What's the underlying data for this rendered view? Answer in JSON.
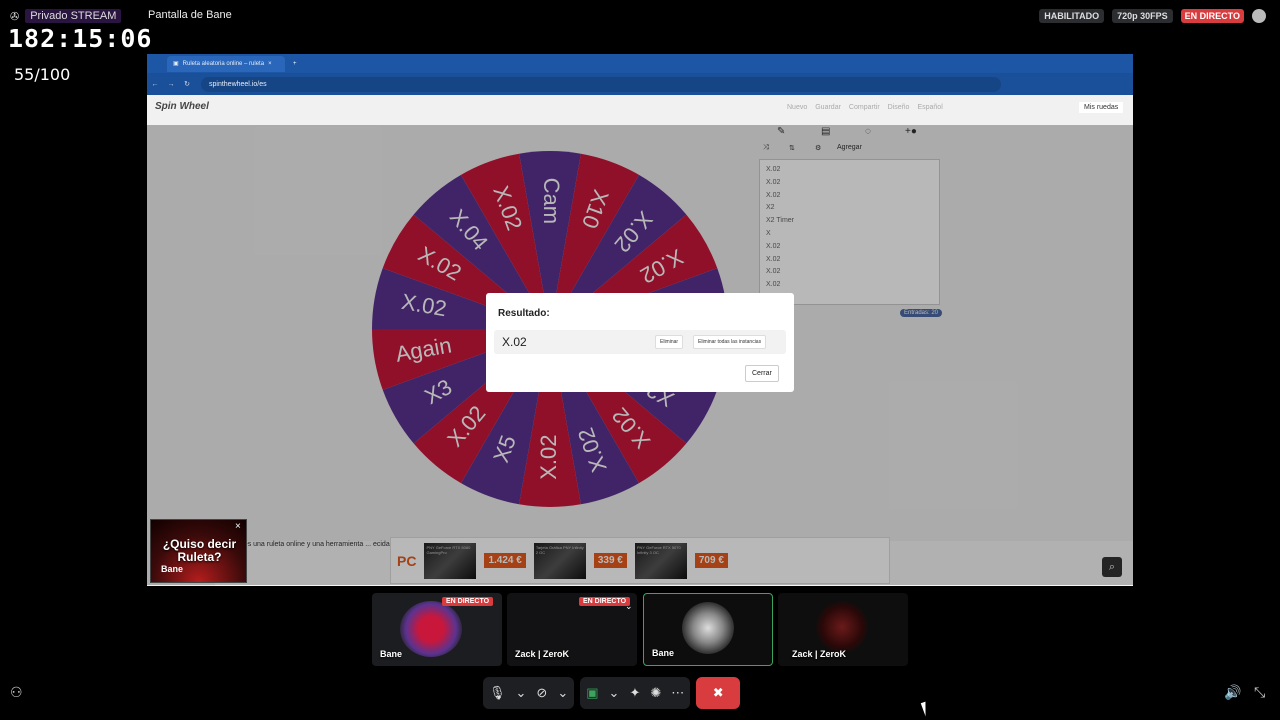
{
  "overlay": {
    "server_name": "Privado STREAM",
    "channel_name": "Pantalla de Bane",
    "clock": "182:15:06",
    "counter": "55/100",
    "enabled_badge": "HABILITADO",
    "quality_badge": "720p 30FPS",
    "live_badge": "EN DIRECTO"
  },
  "browser": {
    "tab_title": "Ruleta aleatoria online – ruleta",
    "url": "spinthewheel.io/es"
  },
  "site": {
    "logo": "Spin Wheel",
    "nav": [
      "Nuevo",
      "Guardar",
      "Compartir",
      "Diseño",
      "Español"
    ],
    "my_wheels": "Mis ruedas",
    "add_button": "Agregar",
    "entries": [
      "X.02",
      "X.02",
      "X.02",
      "X2",
      "X2 Timer",
      "X",
      "X.02",
      "X.02",
      "X.02",
      "X.02"
    ],
    "entries_count": "Entradas: 20",
    "description": "aleatoria es una ruleta online y una herramienta ... ecida por ti. Nuestra aplicación internacional ... plica temas y cambia los sonidos, y deja que la",
    "wheel_colors": {
      "red": "#c8173b",
      "purple": "#5b3390"
    },
    "wheel_labels": [
      "Cam",
      "X10",
      "X.02",
      "X.02",
      "X.02",
      "X2 Timer",
      "X2",
      "X.02",
      "X.02",
      "X.02",
      "X5",
      "X.02",
      "X3",
      "Again",
      "X.02",
      "X.02",
      "X.04",
      "X.02"
    ]
  },
  "modal": {
    "title": "Resultado:",
    "value": "X.02",
    "delete": "Eliminar",
    "delete_all": "Eliminar todas las instancias",
    "close": "Cerrar"
  },
  "ad": {
    "brand": "PC",
    "prices": [
      "1.424 €",
      "339 €",
      "709 €"
    ],
    "products": [
      "PNY GeForce RTX 5080 GamingPro",
      "Tarjeta Gráfica PNY Infinity 2 GC",
      "PNY GeForce RTX 5070 Infinity 3 OC"
    ]
  },
  "popup": {
    "text": "¿Quiso decir Ruleta?",
    "name": "Bane"
  },
  "participants": [
    {
      "name": "Bane",
      "live": "EN DIRECTO"
    },
    {
      "name": "Zack | ZeroK",
      "live": "EN DIRECTO"
    },
    {
      "name": "Bane",
      "live": ""
    },
    {
      "name": "Zack | ZeroK",
      "live": ""
    }
  ],
  "icons": {
    "mic": "microphone-icon",
    "camera_off": "camera-off-icon",
    "screen_share": "screen-share-icon",
    "activities": "activities-icon",
    "soundboard": "soundboard-icon",
    "more": "more-icon",
    "hangup": "hangup-icon",
    "volume": "volume-icon",
    "fullscreen": "exit-fullscreen-icon"
  }
}
